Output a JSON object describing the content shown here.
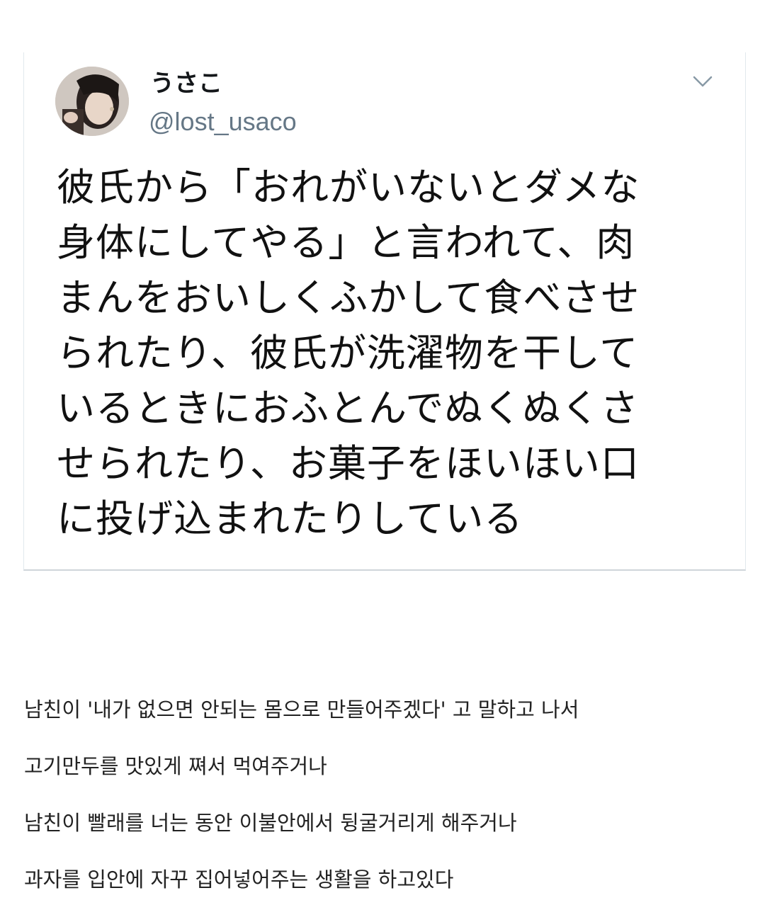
{
  "tweet": {
    "display_name": "うさこ",
    "handle": "@lost_usaco",
    "menu_icon": "chevron-down-icon",
    "text_lines": [
      "彼氏から「おれがいないとダメな",
      "身体にしてやる」と言われて、肉",
      "まんをおいしくふかして食べさせ",
      "られたり、彼氏が洗濯物を干して",
      "いるときにおふとんでぬくぬくさ",
      "せられたり、お菓子をほいほい口",
      "に投げ込まれたりしている"
    ]
  },
  "translation": {
    "lines": [
      "남친이 '내가 없으면 안되는 몸으로 만들어주겠다' 고 말하고 나서",
      "고기만두를 맛있게 쪄서 먹여주거나",
      "남친이 빨래를 너는 동안 이불안에서 뒹굴거리게 해주거나",
      "과자를 입안에 자꾸 집어넣어주는 생활을 하고있다"
    ]
  },
  "colors": {
    "handle": "#657786",
    "name": "#14171a",
    "card_border": "#e1e8ed",
    "chevron": "#8899a6"
  }
}
